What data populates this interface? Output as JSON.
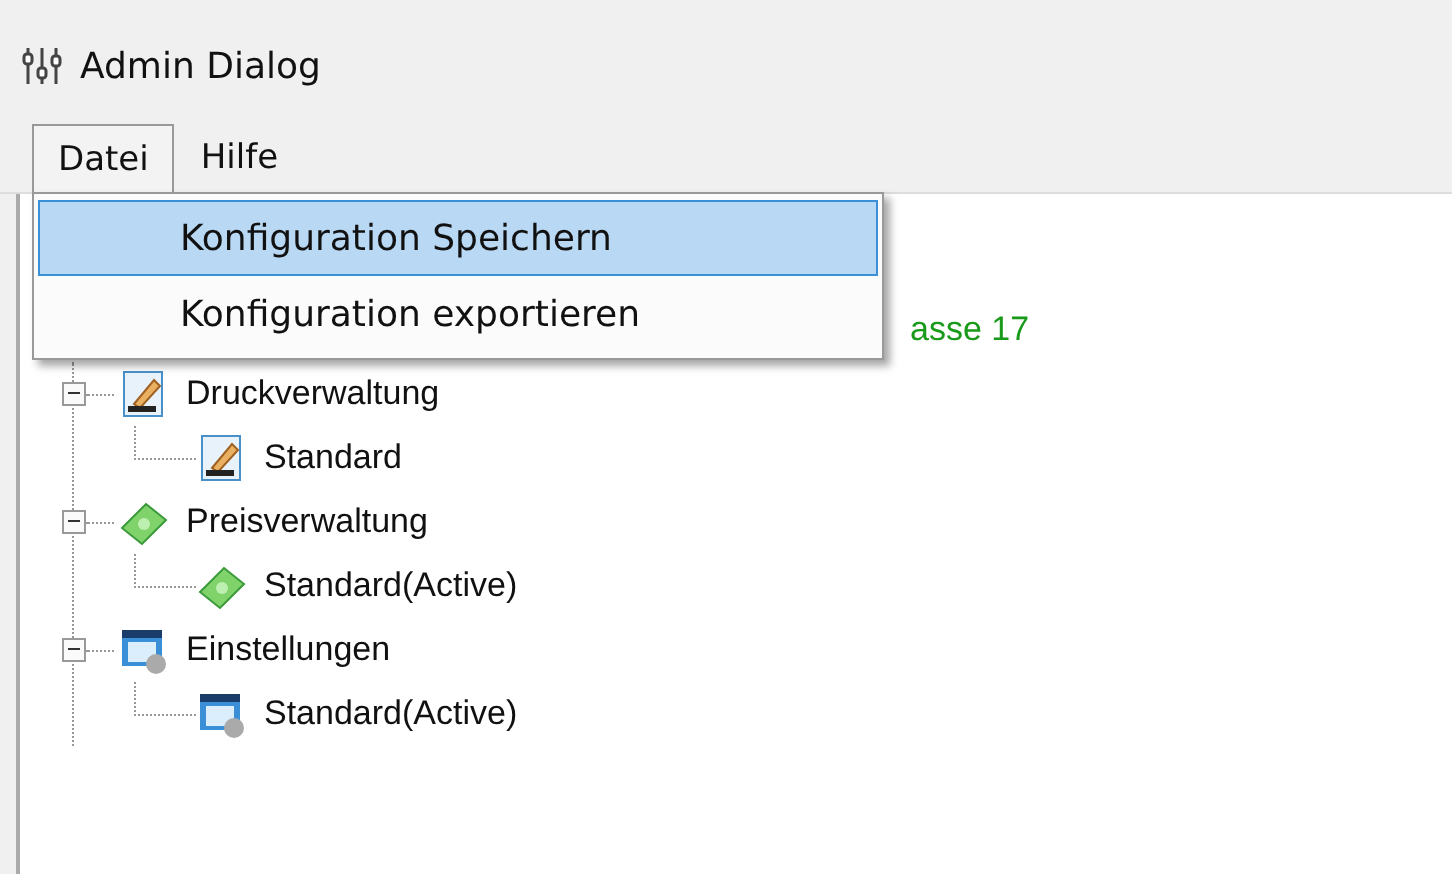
{
  "window": {
    "title": "Admin Dialog"
  },
  "menu": [
    {
      "label": "Datei",
      "selected": true
    },
    {
      "label": "Hilfe",
      "selected": false
    }
  ],
  "dropdown": [
    {
      "label": "Konfiguration Speichern",
      "selected": true
    },
    {
      "label": "Konfiguration exportieren",
      "selected": false
    }
  ],
  "tree": {
    "root_text": "asse 17",
    "nodes": [
      {
        "label": "Druckverwaltung",
        "kind": "print",
        "expanded": true,
        "children": [
          {
            "label": "Standard",
            "kind": "print"
          }
        ]
      },
      {
        "label": "Preisverwaltung",
        "kind": "money",
        "expanded": true,
        "children": [
          {
            "label": "Standard(Active)",
            "kind": "money"
          }
        ]
      },
      {
        "label": "Einstellungen",
        "kind": "settings",
        "expanded": true,
        "children": [
          {
            "label": "Standard(Active)",
            "kind": "settings"
          }
        ]
      }
    ]
  }
}
